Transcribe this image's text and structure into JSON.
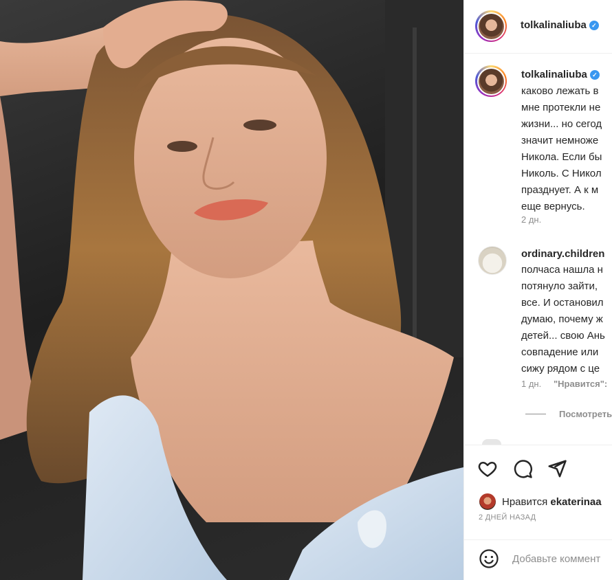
{
  "post": {
    "username": "tolkalinaliuba",
    "verified_mark": "✓",
    "caption_lines": [
      "каково лежать в",
      "мне протекли не",
      "жизни... но сегод",
      "значит немноже",
      "Никола. Если бы",
      "Николь. С Никол",
      "празднует. А к м",
      "еще вернусь."
    ],
    "caption_time": "2 дн."
  },
  "comment": {
    "username": "ordinary.children",
    "lines": [
      "полчаса нашла н",
      "потянуло зайти, ",
      "все. И остановил",
      "думаю, почему ж",
      "детей... свою Ань",
      "совпадение или",
      "сижу рядом с це"
    ],
    "time": "1 дн.",
    "like_label": "\"Нравится\":",
    "view_replies": "Посмотреть"
  },
  "actions": {
    "like_icon": "heart-icon",
    "comment_icon": "comment-icon",
    "share_icon": "paper-plane-icon"
  },
  "likes": {
    "prefix": "Нравится",
    "user": "ekaterinaa"
  },
  "post_date": "2 ДНЕЙ НАЗАД",
  "add_comment": {
    "placeholder": "Добавьте коммент",
    "emoji_icon": "smiley-icon"
  },
  "colors": {
    "verified": "#3897f0",
    "secondary_text": "#8e8e8e",
    "divider": "#efefef"
  }
}
